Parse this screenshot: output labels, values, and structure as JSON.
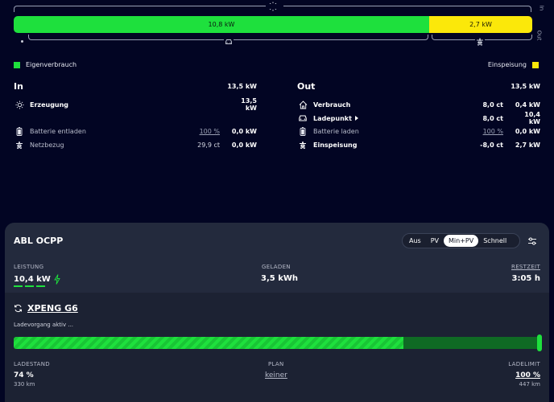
{
  "flow": {
    "in_label": "In",
    "out_label": "Out",
    "self_use_value": "10,8 kW",
    "feed_in_value": "2,7 kW",
    "self_use_fraction": 0.8,
    "colors": {
      "self_use": "#1ee03d",
      "feed_in": "#fbe80a",
      "background": "#020523"
    }
  },
  "legend": {
    "self_use": "Eigenverbrauch",
    "feed_in": "Einspeisung"
  },
  "in": {
    "title": "In",
    "total": "13,5 kW",
    "rows": [
      {
        "icon": "sun-icon",
        "name": "Erzeugung",
        "mid": "",
        "value": "13,5 kW"
      },
      {
        "icon": "battery-icon",
        "name": "Batterie entladen",
        "mid": "100 %",
        "value": "0,0 kW"
      },
      {
        "icon": "power-tower-icon",
        "name": "Netzbezug",
        "mid": "29,9 ct",
        "value": "0,0 kW"
      }
    ]
  },
  "out": {
    "title": "Out",
    "total": "13,5 kW",
    "rows": [
      {
        "icon": "house-icon",
        "name": "Verbrauch",
        "mid": "8,0 ct",
        "value": "0,4 kW"
      },
      {
        "icon": "car-icon",
        "name": "Ladepunkt",
        "mid": "8,0 ct",
        "value": "10,4 kW"
      },
      {
        "icon": "battery-icon",
        "name": "Batterie laden",
        "mid": "100 %",
        "value": "0,0 kW"
      },
      {
        "icon": "power-tower-icon",
        "name": "Einspeisung",
        "mid": "-8,0 ct",
        "value": "2,7 kW"
      }
    ]
  },
  "loadpoint": {
    "title": "ABL OCPP",
    "modes": [
      "Aus",
      "PV",
      "Min+PV",
      "Schnell"
    ],
    "active_mode": "Min+PV",
    "power_label": "LEISTUNG",
    "power_value": "10,4 kW",
    "charged_label": "GELADEN",
    "charged_value": "3,5 kWh",
    "remaining_label": "RESTZEIT",
    "remaining_value": "3:05 h",
    "vehicle": "XPENG G6",
    "status": "Ladevorgang aktiv ...",
    "soc_fraction": 0.74,
    "limit_fraction": 1.0,
    "soc_label": "LADESTAND",
    "soc_value": "74 %",
    "soc_range": "330 km",
    "plan_label": "PLAN",
    "plan_value": "keiner",
    "limit_label": "LADELIMIT",
    "limit_value": "100 %",
    "limit_range": "447 km"
  }
}
